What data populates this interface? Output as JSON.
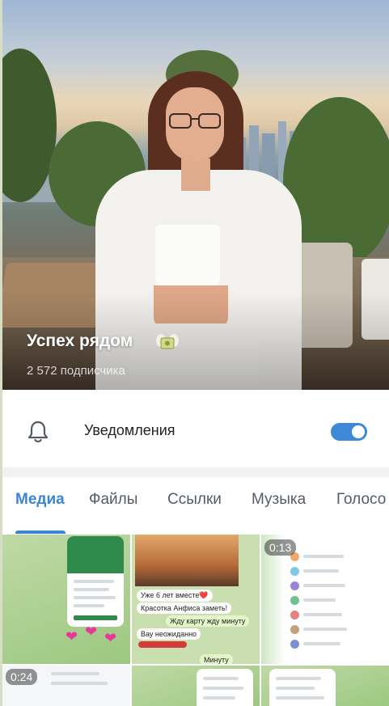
{
  "channel": {
    "title": "Успех рядом",
    "subscribers": "2 572 подписчика"
  },
  "notifications": {
    "label": "Уведомления",
    "enabled": true
  },
  "tabs": [
    {
      "label": "Медиа",
      "active": true
    },
    {
      "label": "Файлы",
      "active": false
    },
    {
      "label": "Ссылки",
      "active": false
    },
    {
      "label": "Музыка",
      "active": false
    },
    {
      "label": "Голосо",
      "active": false
    }
  ],
  "media": {
    "video_durations": [
      "0:13",
      "0:24"
    ],
    "chat_bubbles": [
      "Уже 6 лет вместе❤️",
      "Красотка Анфиса заметь!",
      "Жду карту жду минуту",
      "Вау неожиданно",
      "Минуту"
    ]
  },
  "colors": {
    "accent": "#3a86d4",
    "toggle": "#3e88d8",
    "media_green": "#9cc880"
  }
}
